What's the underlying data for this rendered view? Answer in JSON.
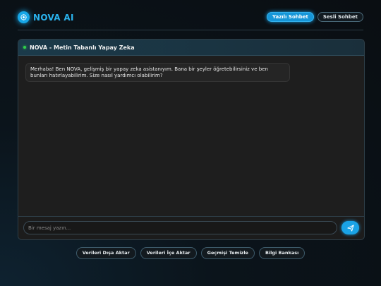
{
  "header": {
    "title": "NOVA AI",
    "modes": [
      {
        "label": "Yazılı Sohbet",
        "active": true
      },
      {
        "label": "Sesli Sohbet",
        "active": false
      }
    ]
  },
  "chat": {
    "title": "NOVA - Metin Tabanlı Yapay Zeka",
    "status_color": "#2fd04a",
    "messages": [
      {
        "sender": "assistant",
        "text": "Merhaba! Ben NOVA, gelişmiş bir yapay zeka asistanıyım. Bana bir şeyler öğretebilirsiniz ve ben bunları hatırlayabilirim. Size nasıl yardımcı olabilirim?"
      }
    ],
    "input": {
      "placeholder": "Bir mesaj yazın...",
      "value": ""
    },
    "send_icon": "send-icon"
  },
  "actions": [
    {
      "label": "Verileri Dışa Aktar"
    },
    {
      "label": "Verileri İçe Aktar"
    },
    {
      "label": "Geçmişi Temizle"
    },
    {
      "label": "Bilgi Bankası"
    }
  ],
  "colors": {
    "accent": "#1aa3e6",
    "background": "#0a0e12"
  }
}
